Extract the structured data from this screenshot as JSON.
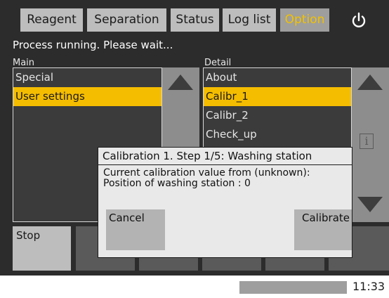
{
  "tabs": [
    {
      "label": "Reagent",
      "active": false
    },
    {
      "label": "Separation",
      "active": false
    },
    {
      "label": "Status",
      "active": false
    },
    {
      "label": "Log list",
      "active": false
    },
    {
      "label": "Option",
      "active": true
    }
  ],
  "power_icon": "power-icon",
  "status_message": "Process running. Please wait...",
  "main_panel": {
    "label": "Main",
    "items": [
      {
        "label": "Special",
        "selected": false
      },
      {
        "label": "User settings",
        "selected": true
      }
    ]
  },
  "detail_panel": {
    "label": "Detail",
    "items": [
      {
        "label": "About",
        "selected": false
      },
      {
        "label": "Calibr_1",
        "selected": true
      },
      {
        "label": "Calibr_2",
        "selected": false
      },
      {
        "label": "Check_up",
        "selected": false
      }
    ]
  },
  "info_icon": "i",
  "bottom": {
    "stop_label": "Stop"
  },
  "dialog": {
    "title": "Calibration 1. Step 1/5: Washing station",
    "line1": "Current calibration value from (unknown):",
    "line2": "Position of washing station : 0",
    "cancel_label": "Cancel",
    "calibrate_label": "Calibrate"
  },
  "statusbar": {
    "time": "11:33"
  },
  "colors": {
    "background": "#2c2c2c",
    "tab": "#bdbdbd",
    "active_tab_text": "#f2c200",
    "selection": "#f5bd00",
    "dialog": "#e9e9e9"
  }
}
